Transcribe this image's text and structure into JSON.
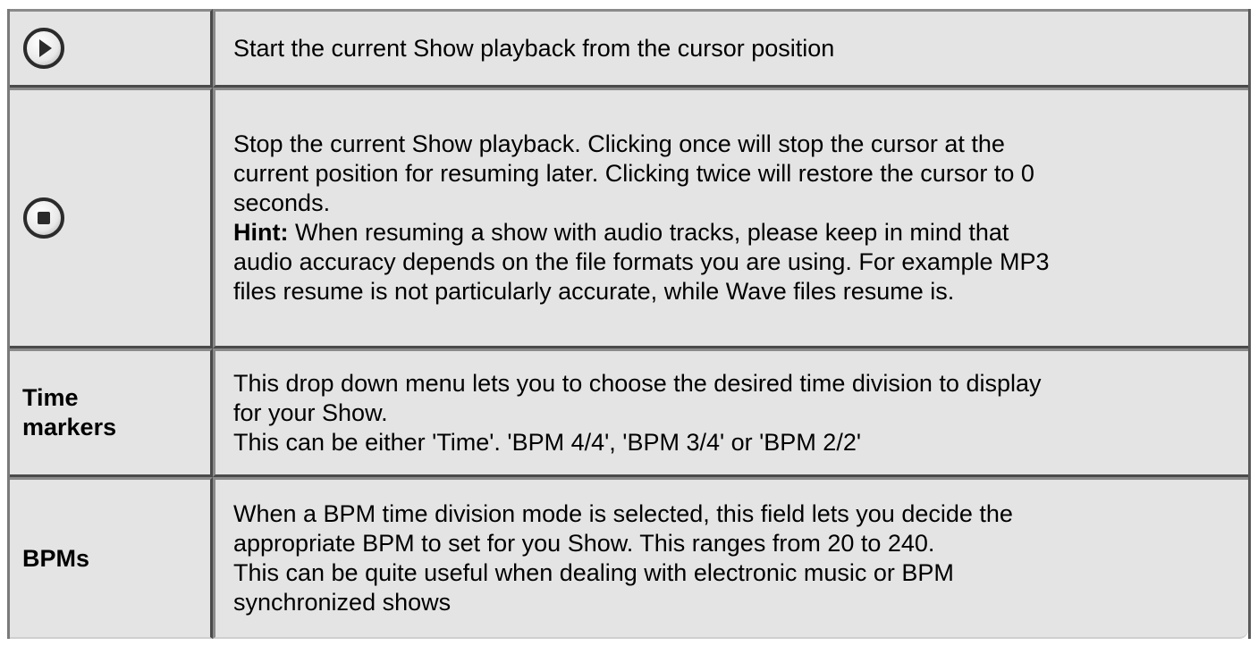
{
  "rows": [
    {
      "icon": "play-circle-icon",
      "text_lines": [
        "Start the current Show playback from the cursor position"
      ]
    },
    {
      "icon": "stop-circle-icon",
      "text_lines": [
        "Stop the current Show playback. Clicking once will stop the cursor at the",
        "current position for resuming later. Clicking twice will restore the cursor to 0",
        "seconds."
      ],
      "hint_label": "Hint:",
      "hint_lines": [
        " When resuming a show with audio tracks, please keep in mind that",
        "audio accuracy depends on the file formats you are using. For example MP3",
        "files resume is not particularly accurate, while Wave files resume is."
      ]
    },
    {
      "label_lines": [
        "Time",
        "markers"
      ],
      "text_lines": [
        "This drop down menu lets you to choose the desired time division to display",
        "for your Show.",
        "This can be either 'Time'. 'BPM 4/4', 'BPM 3/4' or 'BPM 2/2'"
      ]
    },
    {
      "label_lines": [
        "BPMs"
      ],
      "text_lines": [
        "When a BPM time division mode is selected, this field lets you decide the",
        "appropriate BPM to set for you Show. This ranges from 20 to 240.",
        "This can be quite useful when dealing with electronic music or BPM",
        "synchronized shows"
      ]
    }
  ]
}
